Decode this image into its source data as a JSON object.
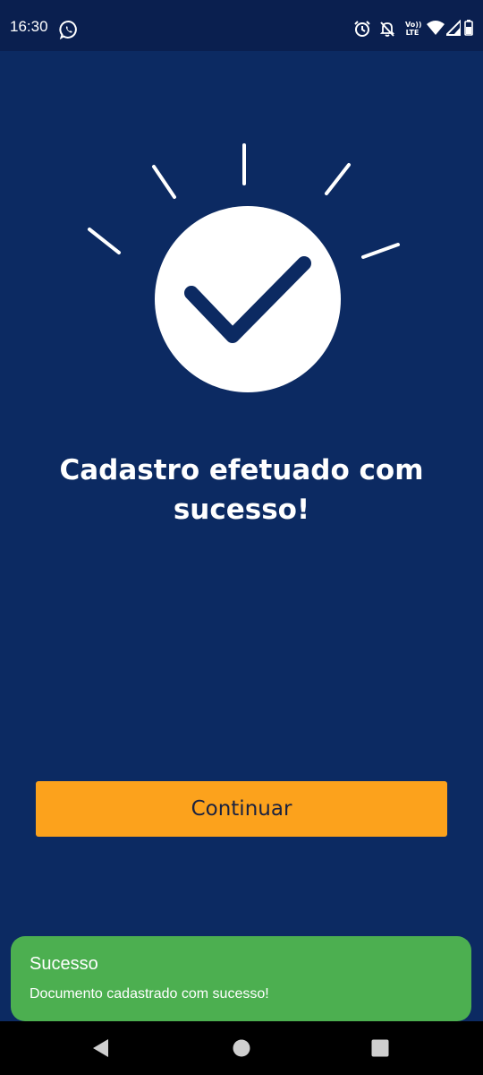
{
  "status_bar": {
    "time": "16:30",
    "lte_line1": "Vo))",
    "lte_line2": "LTE",
    "icons": [
      "whatsapp-icon",
      "alarm-icon",
      "notifications-off-icon",
      "volte-icon",
      "wifi-icon",
      "signal-icon",
      "battery-icon"
    ]
  },
  "hero": {
    "icon": "check-circle-icon",
    "title": "Cadastro efetuado com sucesso!"
  },
  "actions": {
    "continue_label": "Continuar"
  },
  "toast": {
    "title": "Sucesso",
    "message": "Documento cadastrado com sucesso!"
  },
  "nav_bar": {
    "icons": [
      "back-icon",
      "home-icon",
      "recents-icon"
    ]
  },
  "colors": {
    "background": "#0c2a62",
    "status_bar": "#0a1f4f",
    "accent_button": "#fca21c",
    "toast": "#4caf50"
  }
}
